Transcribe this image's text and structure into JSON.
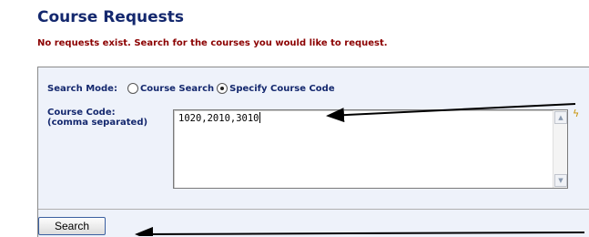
{
  "page": {
    "title": "Course Requests",
    "message": "No requests exist. Search for the courses you would like to request."
  },
  "search_mode": {
    "label": "Search Mode:",
    "options": [
      {
        "label": "Course Search",
        "selected": false
      },
      {
        "label": "Specify Course Code",
        "selected": true
      }
    ]
  },
  "course_code": {
    "label_line1": "Course Code:",
    "label_line2": "(comma separated)",
    "value": "1020,2010,3010"
  },
  "buttons": {
    "search_label": "Search"
  },
  "colors": {
    "title": "#14286e",
    "message": "#8b0000",
    "panel_bg": "#eef2fa"
  }
}
